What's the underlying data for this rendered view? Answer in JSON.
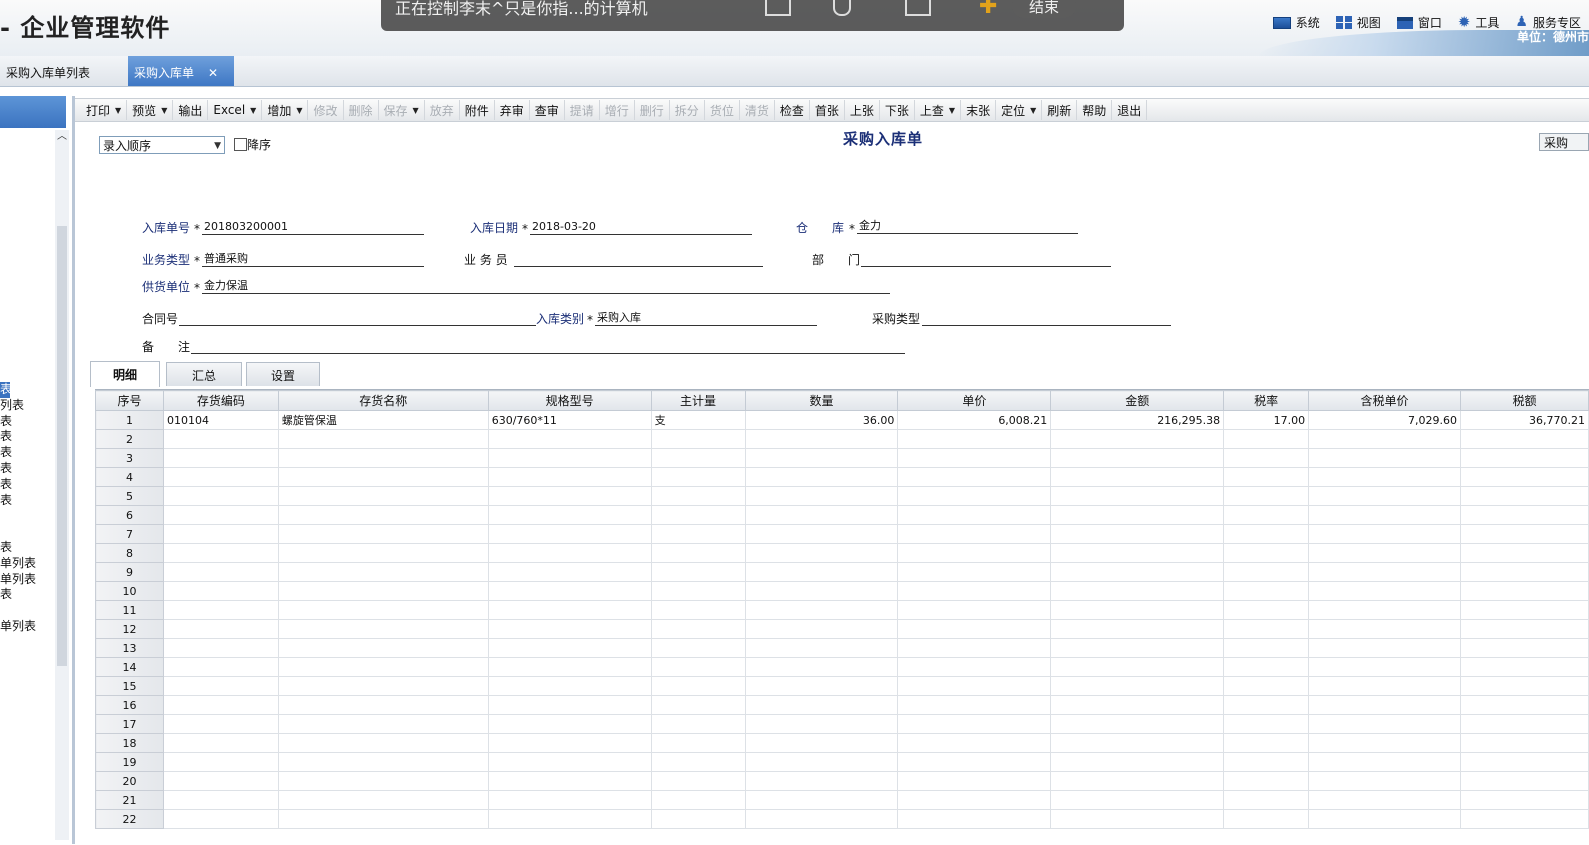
{
  "app": {
    "title": "- 企业管理软件",
    "unit_label": "单位：德州市"
  },
  "top_menu": [
    {
      "label": "系统",
      "icon": "monitor-icon"
    },
    {
      "label": "视图",
      "icon": "grid-icon"
    },
    {
      "label": "窗口",
      "icon": "window-icon"
    },
    {
      "label": "工具",
      "icon": "gear-icon"
    },
    {
      "label": "服务专区",
      "icon": "user-icon"
    }
  ],
  "remote_overlay": {
    "text": "正在控制李末^只是你指...的计算机",
    "end_label": "结束"
  },
  "tabs": [
    {
      "label": "采购入库单列表"
    },
    {
      "label": "采购入库单",
      "close": "✕"
    }
  ],
  "left_nav": [
    {
      "label": "表"
    },
    {
      "label": "列表"
    },
    {
      "label": "表"
    },
    {
      "label": "表"
    },
    {
      "label": "表"
    },
    {
      "label": "表"
    },
    {
      "label": "表"
    },
    {
      "label": "表"
    },
    {
      "label": ""
    },
    {
      "label": ""
    },
    {
      "label": "表"
    },
    {
      "label": "单列表"
    },
    {
      "label": "单列表"
    },
    {
      "label": "表"
    },
    {
      "label": ""
    },
    {
      "label": "单列表"
    }
  ],
  "toolbar": [
    {
      "label": "打印",
      "caret": true,
      "enabled": true
    },
    {
      "label": "预览",
      "caret": true,
      "enabled": true
    },
    {
      "label": "输出",
      "caret": false,
      "enabled": true
    },
    {
      "label": "Excel",
      "caret": true,
      "enabled": true
    },
    {
      "label": "增加",
      "caret": true,
      "enabled": true
    },
    {
      "label": "修改",
      "caret": false,
      "enabled": false
    },
    {
      "label": "删除",
      "caret": false,
      "enabled": false
    },
    {
      "label": "保存",
      "caret": true,
      "enabled": false
    },
    {
      "label": "放弃",
      "caret": false,
      "enabled": false
    },
    {
      "label": "附件",
      "caret": false,
      "enabled": true
    },
    {
      "label": "弃审",
      "caret": false,
      "enabled": true
    },
    {
      "label": "查审",
      "caret": false,
      "enabled": true
    },
    {
      "label": "提请",
      "caret": false,
      "enabled": false
    },
    {
      "label": "增行",
      "caret": false,
      "enabled": false
    },
    {
      "label": "删行",
      "caret": false,
      "enabled": false
    },
    {
      "label": "拆分",
      "caret": false,
      "enabled": false
    },
    {
      "label": "货位",
      "caret": false,
      "enabled": false
    },
    {
      "label": "清货",
      "caret": false,
      "enabled": false
    },
    {
      "label": "检查",
      "caret": false,
      "enabled": true
    },
    {
      "label": "首张",
      "caret": false,
      "enabled": true
    },
    {
      "label": "上张",
      "caret": false,
      "enabled": true
    },
    {
      "label": "下张",
      "caret": false,
      "enabled": true
    },
    {
      "label": "上查",
      "caret": true,
      "enabled": true
    },
    {
      "label": "末张",
      "caret": false,
      "enabled": true
    },
    {
      "label": "定位",
      "caret": true,
      "enabled": true
    },
    {
      "label": "刷新",
      "caret": false,
      "enabled": true
    },
    {
      "label": "帮助",
      "caret": false,
      "enabled": true
    },
    {
      "label": "退出",
      "caret": false,
      "enabled": true
    }
  ],
  "form": {
    "sort_option": "录入顺序",
    "desc_label": "降序",
    "title": "采购入库单",
    "right_button": "采购",
    "required_mark": "*",
    "fields": {
      "receipt_no": {
        "label": "入库单号",
        "value": "201803200001"
      },
      "receipt_date": {
        "label": "入库日期",
        "value": "2018-03-20"
      },
      "warehouse": {
        "label": "仓　　库",
        "value": "金力"
      },
      "business_type": {
        "label": "业务类型",
        "value": "普通采购"
      },
      "salesperson": {
        "label": "业 务 员",
        "value": ""
      },
      "department": {
        "label": "部　　门",
        "value": ""
      },
      "supplier": {
        "label": "供货单位",
        "value": "金力保温"
      },
      "contract_no": {
        "label": "合同号",
        "value": ""
      },
      "receipt_category": {
        "label": "入库类别",
        "value": "采购入库"
      },
      "purchase_type": {
        "label": "采购类型",
        "value": ""
      },
      "remark": {
        "label": "备　　注",
        "value": ""
      }
    }
  },
  "sub_tabs": [
    {
      "label": "明细"
    },
    {
      "label": "汇总"
    },
    {
      "label": "设置"
    }
  ],
  "grid": {
    "columns": [
      "序号",
      "存货编码",
      "存货名称",
      "规格型号",
      "主计量",
      "数量",
      "单价",
      "金额",
      "税率",
      "含税单价",
      "税额"
    ],
    "rows": [
      [
        "1",
        "010104",
        "螺旋管保温",
        "630/760*11",
        "支",
        "36.00",
        "6,008.21",
        "216,295.38",
        "17.00",
        "7,029.60",
        "36,770.21"
      ],
      [
        "2",
        "",
        "",
        "",
        "",
        "",
        "",
        "",
        "",
        "",
        ""
      ],
      [
        "3",
        "",
        "",
        "",
        "",
        "",
        "",
        "",
        "",
        "",
        ""
      ],
      [
        "4",
        "",
        "",
        "",
        "",
        "",
        "",
        "",
        "",
        "",
        ""
      ],
      [
        "5",
        "",
        "",
        "",
        "",
        "",
        "",
        "",
        "",
        "",
        ""
      ],
      [
        "6",
        "",
        "",
        "",
        "",
        "",
        "",
        "",
        "",
        "",
        ""
      ],
      [
        "7",
        "",
        "",
        "",
        "",
        "",
        "",
        "",
        "",
        "",
        ""
      ],
      [
        "8",
        "",
        "",
        "",
        "",
        "",
        "",
        "",
        "",
        "",
        ""
      ],
      [
        "9",
        "",
        "",
        "",
        "",
        "",
        "",
        "",
        "",
        "",
        ""
      ],
      [
        "10",
        "",
        "",
        "",
        "",
        "",
        "",
        "",
        "",
        "",
        ""
      ],
      [
        "11",
        "",
        "",
        "",
        "",
        "",
        "",
        "",
        "",
        "",
        ""
      ],
      [
        "12",
        "",
        "",
        "",
        "",
        "",
        "",
        "",
        "",
        "",
        ""
      ],
      [
        "13",
        "",
        "",
        "",
        "",
        "",
        "",
        "",
        "",
        "",
        ""
      ],
      [
        "14",
        "",
        "",
        "",
        "",
        "",
        "",
        "",
        "",
        "",
        ""
      ],
      [
        "15",
        "",
        "",
        "",
        "",
        "",
        "",
        "",
        "",
        "",
        ""
      ],
      [
        "16",
        "",
        "",
        "",
        "",
        "",
        "",
        "",
        "",
        "",
        ""
      ],
      [
        "17",
        "",
        "",
        "",
        "",
        "",
        "",
        "",
        "",
        "",
        ""
      ],
      [
        "18",
        "",
        "",
        "",
        "",
        "",
        "",
        "",
        "",
        "",
        ""
      ],
      [
        "19",
        "",
        "",
        "",
        "",
        "",
        "",
        "",
        "",
        "",
        ""
      ],
      [
        "20",
        "",
        "",
        "",
        "",
        "",
        "",
        "",
        "",
        "",
        ""
      ],
      [
        "21",
        "",
        "",
        "",
        "",
        "",
        "",
        "",
        "",
        "",
        ""
      ],
      [
        "22",
        "",
        "",
        "",
        "",
        "",
        "",
        "",
        "",
        "",
        ""
      ]
    ]
  },
  "colors": {
    "accent": "#3b73c0",
    "label": "#1b2f77"
  }
}
